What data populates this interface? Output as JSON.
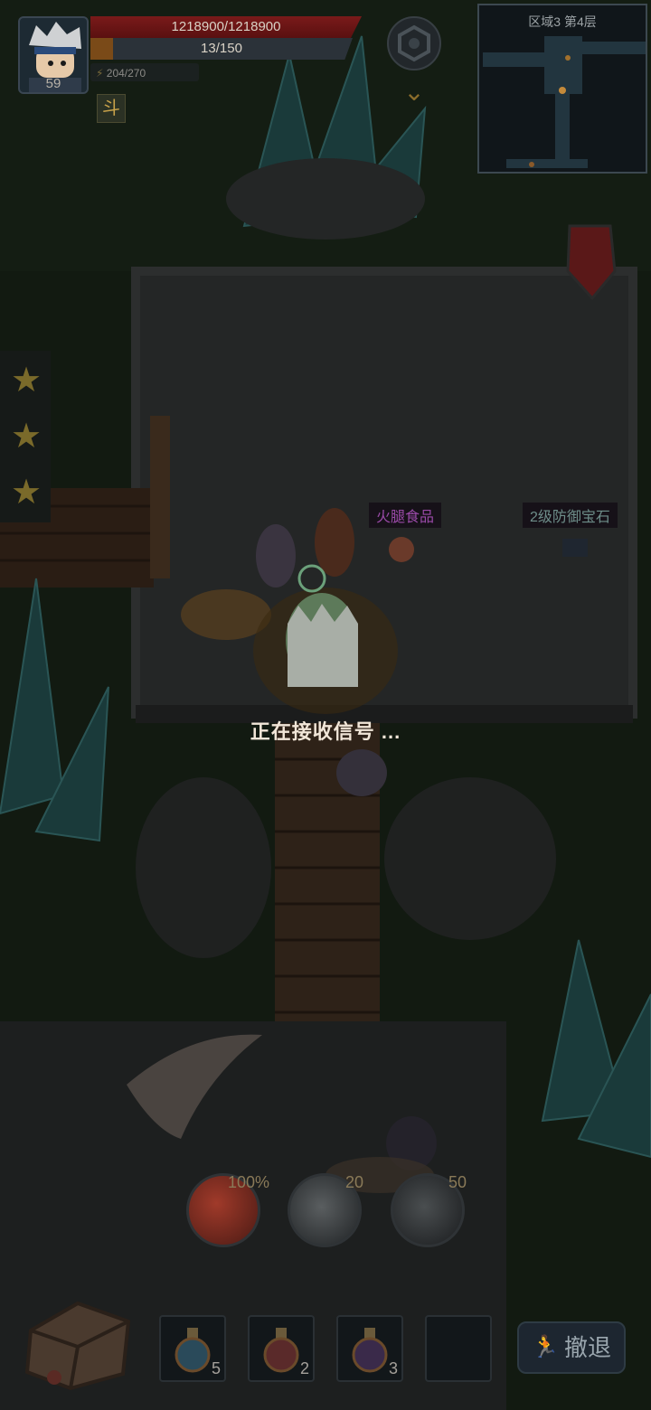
{
  "player": {
    "level": "59",
    "hp_text": "1218900/1218900",
    "exp_text": "13/150",
    "exp_fraction": 0.087,
    "energy_text": "204/270"
  },
  "minimap": {
    "title": "区域3 第4层"
  },
  "floor_items": [
    {
      "label": "火腿食品"
    },
    {
      "label": "2级防御宝石"
    }
  ],
  "status_message": "正在接收信号 ...",
  "skills": [
    {
      "name": "fire-skill",
      "label": "100%"
    },
    {
      "name": "stone-skill",
      "label": "20"
    },
    {
      "name": "slash-skill",
      "label": "50"
    }
  ],
  "potion_slots": [
    {
      "icon": "potion-icon",
      "count": "5"
    },
    {
      "icon": "potion-icon",
      "count": "2"
    },
    {
      "icon": "potion-icon",
      "count": "3"
    },
    {
      "icon": "",
      "count": ""
    }
  ],
  "retreat": {
    "label": "撤退"
  },
  "colors": {
    "hp": "#7a1a1a",
    "exp": "#7a4a18",
    "ham_label": "#9a4aa8",
    "gem_label": "#6e8e8a"
  }
}
